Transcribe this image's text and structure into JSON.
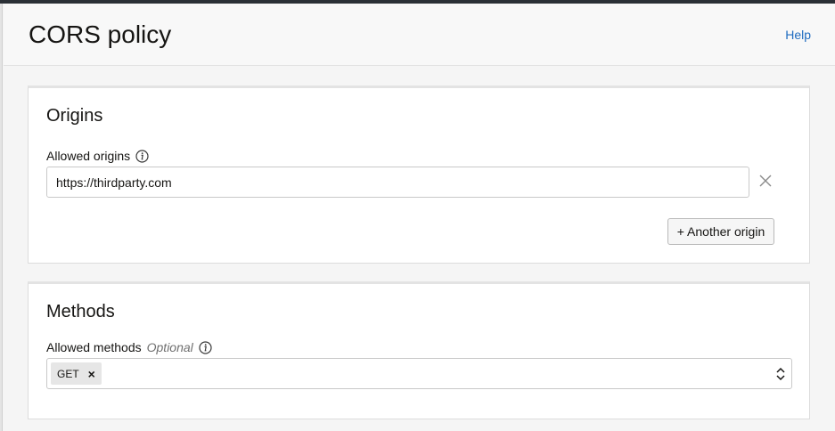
{
  "header": {
    "title": "CORS policy",
    "help_label": "Help"
  },
  "origins": {
    "heading": "Origins",
    "allowed_label": "Allowed origins",
    "input_value": "https://thirdparty.com",
    "add_button": "+ Another origin"
  },
  "methods": {
    "heading": "Methods",
    "allowed_label": "Allowed methods",
    "optional_label": "Optional",
    "selected": [
      {
        "label": "GET",
        "remove": "×"
      }
    ]
  },
  "icons": {
    "info": "info-icon",
    "remove": "close-icon",
    "select": "chevron-up-down-icon"
  },
  "colors": {
    "link": "#1f6cc0",
    "topbar": "#2b3036"
  }
}
